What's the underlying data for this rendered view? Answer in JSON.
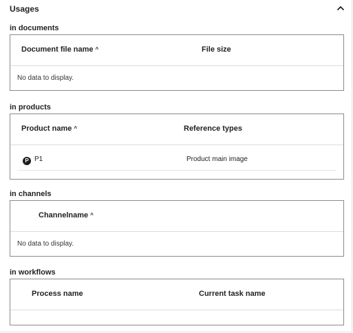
{
  "panel": {
    "title": "Usages"
  },
  "documents": {
    "title": "in documents",
    "columns": [
      "Document file name",
      "File size"
    ],
    "empty_text": "No data to display."
  },
  "products": {
    "title": "in products",
    "columns": [
      "Product name",
      "Reference types"
    ],
    "rows": [
      {
        "badge": "P",
        "name": "P1",
        "reference_type": "Product main image"
      }
    ]
  },
  "channels": {
    "title": "in channels",
    "columns": [
      "Channelname"
    ],
    "empty_text": "No data to display."
  },
  "workflows": {
    "title": "in workflows",
    "columns": [
      "Process name",
      "Current task name"
    ]
  },
  "icons": {
    "collapse": "chevron-up-icon",
    "sort": "sort-ascending-icon",
    "product_badge": "product-badge-icon"
  }
}
